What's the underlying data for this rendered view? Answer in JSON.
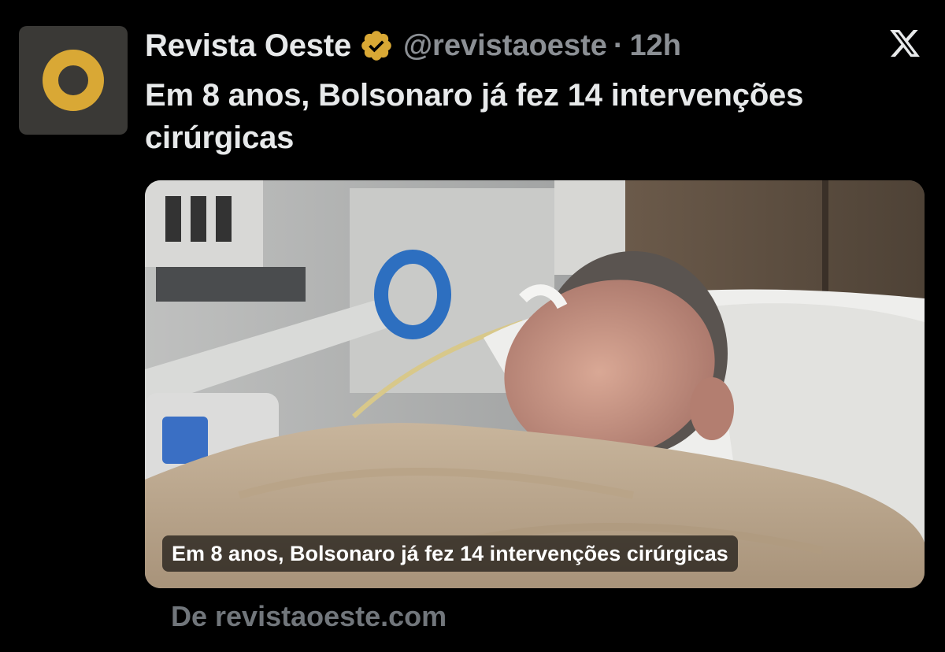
{
  "tweet": {
    "display_name": "Revista Oeste",
    "handle": "@revistaoeste",
    "separator": "·",
    "time": "12h",
    "verified": true,
    "text": "Em 8 anos, Bolsonaro já fez 14 intervenções cirúrgicas",
    "avatar_icon": "revista-oeste-o-logo",
    "platform_icon": "x-logo"
  },
  "media": {
    "caption": "Em 8 anos, Bolsonaro já fez 14 intervenções cirúrgicas",
    "photo_icon": "hospital-patient-photo"
  },
  "link": {
    "source": "De revistaoeste.com"
  },
  "colors": {
    "background": "#000000",
    "primary_text": "#e7e9ea",
    "secondary_text": "#8b8f94",
    "verified_badge": "#d9a835",
    "avatar_bg": "#3a3936",
    "avatar_ring": "#d9a835"
  }
}
